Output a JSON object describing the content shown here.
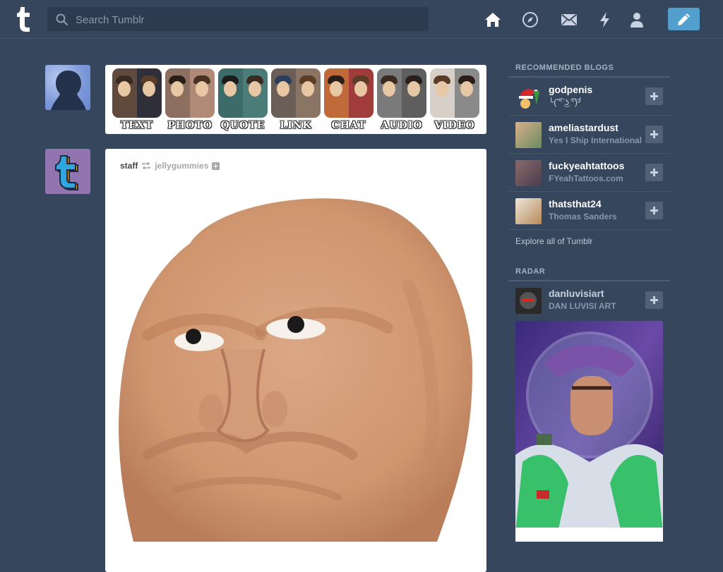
{
  "header": {
    "logo": "t",
    "search_placeholder": "Search Tumblr",
    "nav_icons": [
      "home-icon",
      "compass-icon",
      "mail-icon",
      "lightning-icon",
      "account-icon"
    ],
    "compose_icon": "pencil-icon"
  },
  "composer": {
    "types": [
      {
        "label": "TEXT"
      },
      {
        "label": "PHOTO"
      },
      {
        "label": "QUOTE"
      },
      {
        "label": "LINK"
      },
      {
        "label": "CHAT"
      },
      {
        "label": "AUDIO"
      },
      {
        "label": "VIDEO"
      }
    ]
  },
  "post": {
    "author": "staff",
    "reblogged_from": "jellygummies"
  },
  "sidebar": {
    "recommended_title": "RECOMMENDED BLOGS",
    "recommended": [
      {
        "name": "godpenis",
        "subtitle": "╰(̃ ͡° ͜ʖ ͡°)̃╯"
      },
      {
        "name": "ameliastardust",
        "subtitle": "Yes I Ship International"
      },
      {
        "name": "fuckyeahtattoos",
        "subtitle": "FYeahTattoos.com"
      },
      {
        "name": "thatsthat24",
        "subtitle": "Thomas Sanders"
      }
    ],
    "explore_label": "Explore all of Tumblr",
    "radar_title": "RADAR",
    "radar": {
      "name": "danluvisiart",
      "subtitle": "DAN LUVISI ART"
    }
  },
  "colors": {
    "background": "#36465d",
    "search_bg": "#2c3b50",
    "compose_button": "#529ecc",
    "follow_button": "#526177"
  }
}
